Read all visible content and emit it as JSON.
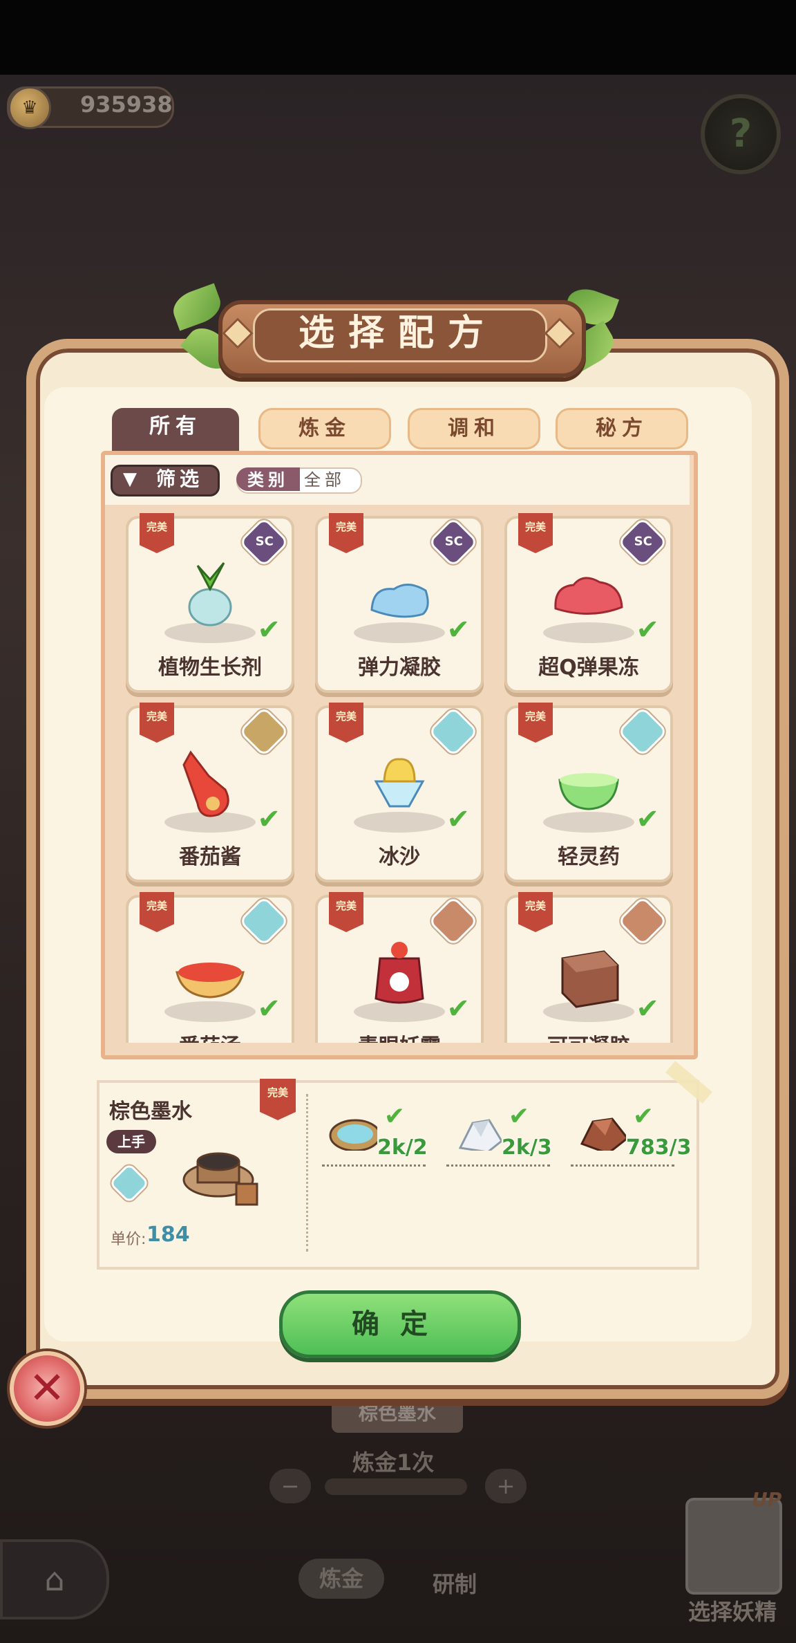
{
  "hud": {
    "coins": "935938",
    "help_icon": "question-mark-sprout"
  },
  "dialog": {
    "title": "选择配方",
    "tabs": [
      "所有",
      "炼金",
      "调和",
      "秘方"
    ],
    "filter": {
      "label": "筛选",
      "category_key": "类别",
      "category_value": "全部"
    },
    "recipes": [
      {
        "name": "植物生长剂",
        "badge": "完美",
        "type": "SC",
        "type_color": "#6a4e7e",
        "art": "plant-in-glass-bottle",
        "checked": true
      },
      {
        "name": "弹力凝胶",
        "badge": "完美",
        "type": "SC",
        "type_color": "#6a4e7e",
        "art": "blue-gel",
        "checked": true
      },
      {
        "name": "超Q弹果冻",
        "badge": "完美",
        "type": "SC",
        "type_color": "#6a4e7e",
        "art": "red-jelly",
        "checked": true
      },
      {
        "name": "番茄酱",
        "badge": "完美",
        "type": "",
        "type_color": "#c8a766",
        "art": "ketchup-bottle",
        "checked": true
      },
      {
        "name": "冰沙",
        "badge": "完美",
        "type": "",
        "type_color": "#8ed4d8",
        "art": "shaved-ice",
        "checked": true
      },
      {
        "name": "轻灵药",
        "badge": "完美",
        "type": "",
        "type_color": "#8ed4d8",
        "art": "green-potion-bowl",
        "checked": true
      },
      {
        "name": "番茄汤",
        "badge": "完美",
        "type": "",
        "type_color": "#8ed4d8",
        "art": "tomato-soup",
        "checked": true
      },
      {
        "name": "青眼妖露",
        "badge": "完美",
        "type": "",
        "type_color": "#c98a6a",
        "art": "strawberry-jar",
        "checked": true
      },
      {
        "name": "可可凝胶",
        "badge": "完美",
        "type": "",
        "type_color": "#c98a6a",
        "art": "chocolate-cube",
        "checked": true
      }
    ],
    "detail": {
      "name": "棕色墨水",
      "badge": "完美",
      "rank": "上手",
      "price_label": "单价:",
      "price_value": "184",
      "ingredients": [
        {
          "art": "blue-water-dish",
          "count": "2k/2",
          "checked": true
        },
        {
          "art": "white-crystal",
          "count": "2k/3",
          "checked": true
        },
        {
          "art": "brown-ore",
          "count": "783/3",
          "checked": true
        }
      ]
    },
    "confirm": "确定",
    "close_icon": "close-x"
  },
  "background": {
    "selected_item": "棕色墨水",
    "alchemy_count": "炼金1次",
    "bottom_tabs": [
      "炼金",
      "研制"
    ],
    "select_fairy": "选择妖精",
    "up_label": "UP"
  },
  "colors": {
    "accent_green": "#4fbf56",
    "badge_red": "#c2493a",
    "tab_active": "#6d4a4a",
    "panel_cream": "#f6ead2"
  }
}
